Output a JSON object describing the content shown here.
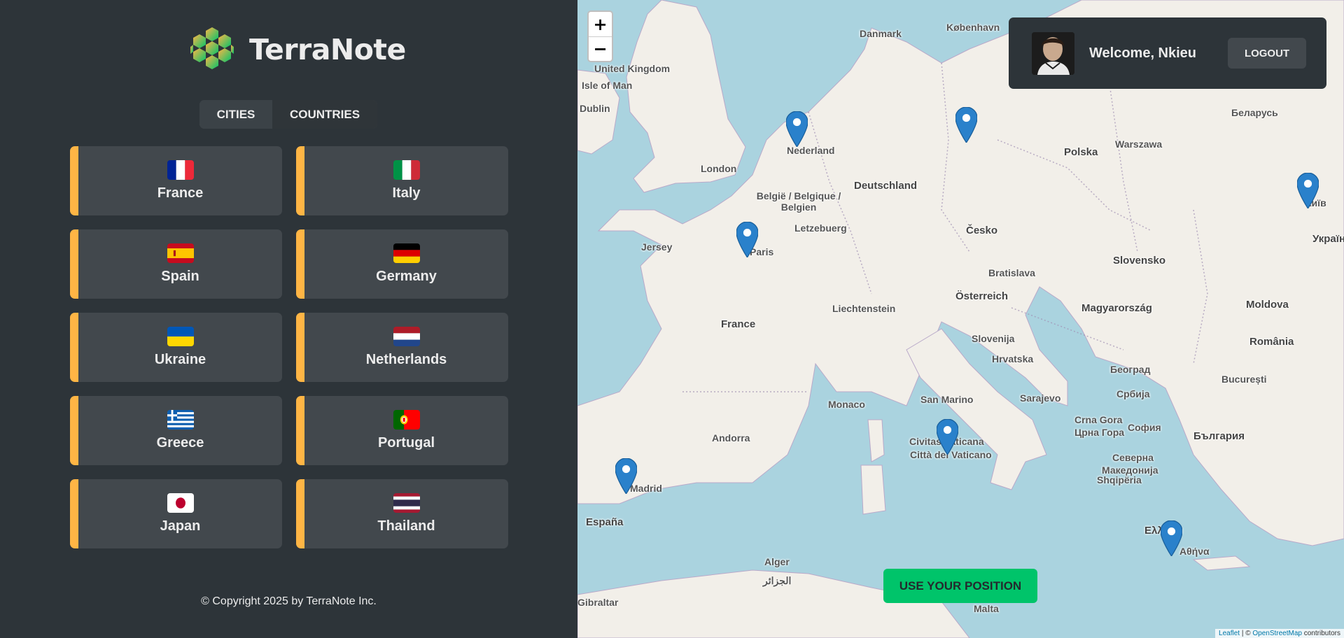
{
  "app": {
    "name": "TerraNote",
    "copyright": "© Copyright 2025 by TerraNote Inc."
  },
  "tabs": [
    {
      "label": "CITIES",
      "active": true
    },
    {
      "label": "COUNTRIES",
      "active": false
    }
  ],
  "countries": [
    {
      "name": "France",
      "flag": "fr"
    },
    {
      "name": "Italy",
      "flag": "it"
    },
    {
      "name": "Spain",
      "flag": "es"
    },
    {
      "name": "Germany",
      "flag": "de"
    },
    {
      "name": "Ukraine",
      "flag": "ua"
    },
    {
      "name": "Netherlands",
      "flag": "nl"
    },
    {
      "name": "Greece",
      "flag": "gr"
    },
    {
      "name": "Portugal",
      "flag": "pt"
    },
    {
      "name": "Japan",
      "flag": "jp"
    },
    {
      "name": "Thailand",
      "flag": "th"
    }
  ],
  "map": {
    "zoom_in": "+",
    "zoom_out": "−",
    "use_position": "USE YOUR POSITION",
    "attribution_leaflet": "Leaflet",
    "attribution_sep": " | © ",
    "attribution_osm": "OpenStreetMap",
    "attribution_tail": " contributors",
    "labels": [
      "Danmark",
      "København",
      "United Kingdom",
      "Isle of Man",
      "Dublin",
      "London",
      "Nederland",
      "België / Belgique / Belgien",
      "Letzebuerg",
      "Deutschland",
      "Polska",
      "Warszawa",
      "Беларусь",
      "Jersey",
      "Paris",
      "France",
      "Česko",
      "Slovensko",
      "Bratislava",
      "Österreich",
      "Liechtenstein",
      "Magyarország",
      "Moldova",
      "Україна",
      "Київ",
      "Slovenija",
      "Hrvatska",
      "Београд",
      "Србија",
      "România",
      "București",
      "Monaco",
      "San Marino",
      "Sarajevo",
      "Andorra",
      "Civitas Vaticana",
      "Città del Vaticano",
      "Crna Gora",
      "Црна Гора",
      "София",
      "България",
      "Северна",
      "Македонија",
      "Shqipëria",
      "Madrid",
      "España",
      "Ελλάδα",
      "Αθήνα",
      "Alger",
      "الجزائر",
      "Malta",
      "Gibraltar"
    ]
  },
  "user": {
    "welcome": "Welcome, Nkieu",
    "logout": "LOGOUT"
  },
  "colors": {
    "sidebar_bg": "#2d3439",
    "card_bg": "#42484d",
    "card_accent": "#ffb545",
    "primary_green": "#00c46a",
    "text": "#ececec",
    "sea": "#aad3df",
    "land": "#f2efe9",
    "marker": "#2a81cb"
  }
}
